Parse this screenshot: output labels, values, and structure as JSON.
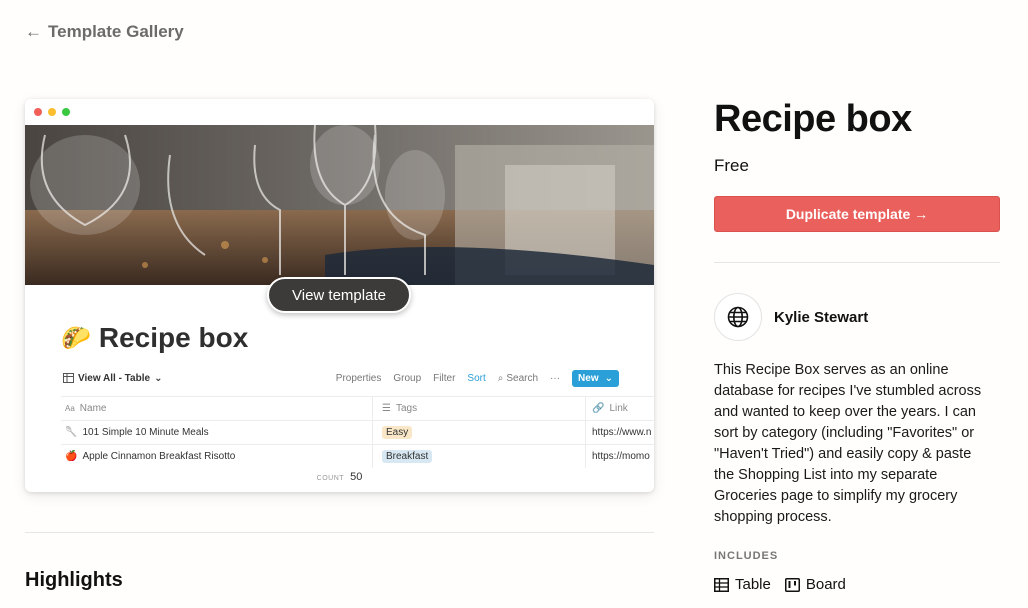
{
  "nav": {
    "back_label": "Template Gallery"
  },
  "preview": {
    "view_button": "View template",
    "page_title": "Recipe box",
    "page_emoji": "🌮",
    "toolbar": {
      "view_label": "View All - Table",
      "properties": "Properties",
      "group": "Group",
      "filter": "Filter",
      "sort": "Sort",
      "search": "Search",
      "more": "···",
      "new": "New"
    },
    "columns": [
      "Name",
      "Tags",
      "Link"
    ],
    "rows": [
      {
        "emoji": "🥄",
        "name": "101 Simple 10 Minute Meals",
        "tag": "Easy",
        "link": "https://www.n"
      },
      {
        "emoji": "🍎",
        "name": "Apple Cinnamon Breakfast Risotto",
        "tag": "Breakfast",
        "link": "https://momo"
      }
    ],
    "count_label": "COUNT",
    "count_value": "50"
  },
  "section": {
    "highlights": "Highlights"
  },
  "detail": {
    "title": "Recipe box",
    "price": "Free",
    "duplicate_button": "Duplicate template →",
    "author": "Kylie Stewart",
    "description": "This Recipe Box serves as an online database for recipes I've stumbled across and wanted to keep over the years. I can sort by category (including \"Favorites\" or \"Haven't Tried\") and easily copy & paste the Shopping List into my separate Groceries page to simplify my grocery shopping process.",
    "includes_label": "INCLUDES",
    "includes": [
      "Table",
      "Board"
    ]
  },
  "colors": {
    "accent_red": "#e9605c",
    "link_blue": "#2a9fd8",
    "tag_easy": "#f9e7c7",
    "tag_breakfast": "#d7e8f3"
  }
}
